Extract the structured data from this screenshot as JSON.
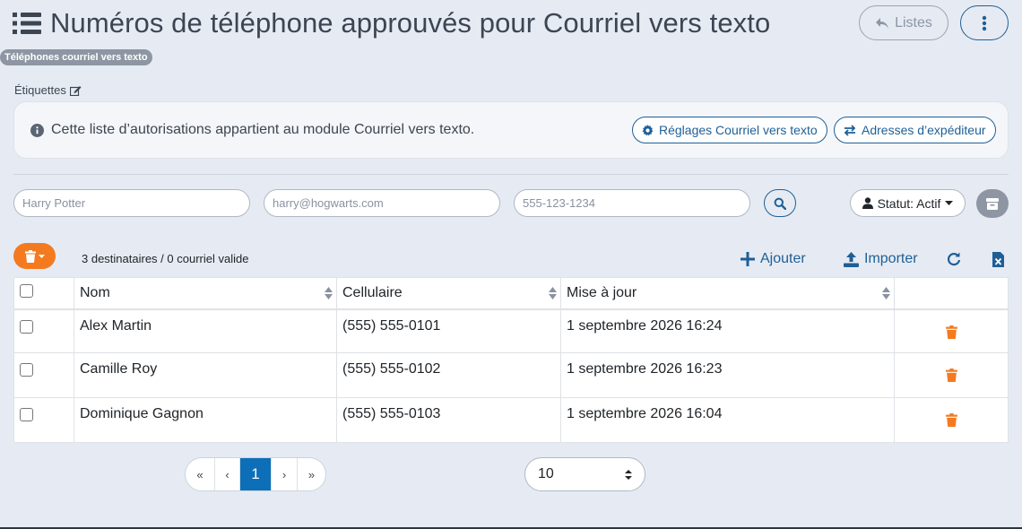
{
  "header": {
    "title": "Numéros de téléphone approuvés pour Courriel vers texto",
    "lists_button": "Listes"
  },
  "tag_badge": "Téléphones courriel vers texto",
  "labels_link": "Étiquettes",
  "info_panel": {
    "text": "Cette liste d’autorisations appartient au module Courriel vers texto.",
    "settings_button": "Réglages Courriel vers texto",
    "sender_button": "Adresses d’expéditeur"
  },
  "filters": {
    "name_placeholder": "Harry Potter",
    "email_placeholder": "harry@hogwarts.com",
    "phone_placeholder": "555-123-1234",
    "status_label": "Statut: Actif"
  },
  "toolbar": {
    "count_text": "3 destinataires / 0 courriel valide",
    "add_label": "Ajouter",
    "import_label": "Importer"
  },
  "table": {
    "columns": [
      "Nom",
      "Cellulaire",
      "Mise à jour"
    ],
    "rows": [
      {
        "name": "Alex Martin",
        "phone": "(555) 555-0101",
        "updated": "1 septembre 2026 16:24"
      },
      {
        "name": "Camille Roy",
        "phone": "(555) 555-0102",
        "updated": "1 septembre 2026 16:23"
      },
      {
        "name": "Dominique Gagnon",
        "phone": "(555) 555-0103",
        "updated": "1 septembre 2026 16:04"
      }
    ]
  },
  "pagination": {
    "first": "«",
    "prev": "‹",
    "current": "1",
    "next": "›",
    "last": "»",
    "page_size": "10"
  },
  "colors": {
    "primary": "#1f5f96",
    "accent_orange": "#f47a20",
    "background": "#e6ebf3",
    "active_page": "#0d6fb8"
  },
  "icons": [
    "list-icon",
    "undo-icon",
    "kebab-icon",
    "edit-icon",
    "info-icon",
    "gear-icon",
    "exchange-icon",
    "search-icon",
    "user-icon",
    "archive-icon",
    "trash-icon",
    "plus-icon",
    "upload-icon",
    "refresh-icon",
    "excel-icon",
    "sort-icon"
  ]
}
